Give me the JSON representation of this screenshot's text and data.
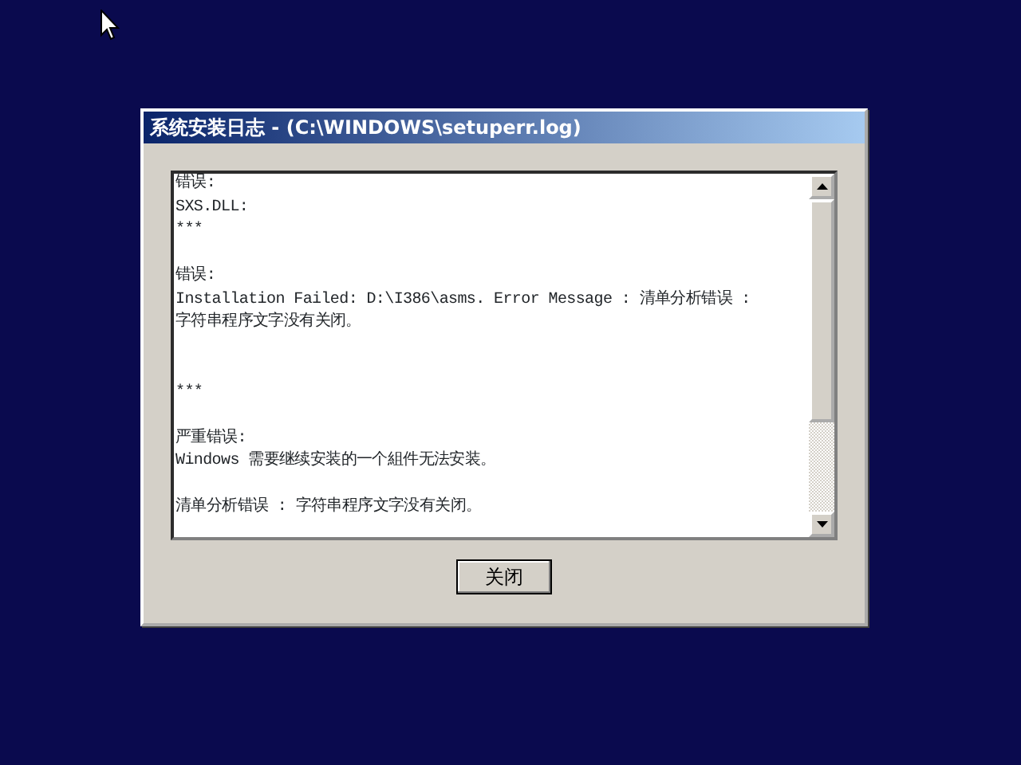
{
  "window": {
    "title": "系统安装日志 - (C:\\WINDOWS\\setuperr.log)"
  },
  "log_lines": [
    {
      "kind": "text",
      "text": "错误:"
    },
    {
      "kind": "text",
      "text": "SXS.DLL:"
    },
    {
      "kind": "text",
      "text": "***"
    },
    {
      "kind": "blank"
    },
    {
      "kind": "text",
      "text": "错误:"
    },
    {
      "kind": "text",
      "text": "Installation Failed: D:\\I386\\asms. Error Message : 清单分析错误 :"
    },
    {
      "kind": "text",
      "text": "字符串程序文字没有关闭。"
    },
    {
      "kind": "blank"
    },
    {
      "kind": "blank"
    },
    {
      "kind": "text",
      "text": "***"
    },
    {
      "kind": "blank"
    },
    {
      "kind": "text",
      "text": "严重错误:"
    },
    {
      "kind": "text",
      "text": "Windows 需要继续安装的一个組件无法安装。"
    },
    {
      "kind": "blank"
    },
    {
      "kind": "text",
      "text": "清单分析错误 : 字符串程序文字没有关闭。"
    }
  ],
  "buttons": [
    {
      "label": "关闭"
    }
  ]
}
